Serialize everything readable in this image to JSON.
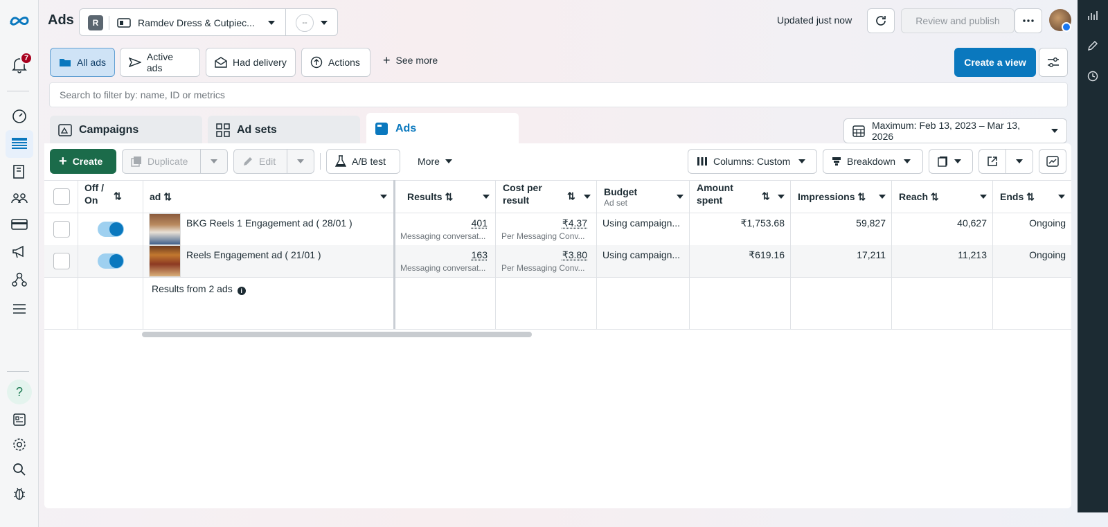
{
  "header": {
    "title": "Ads",
    "account_initial": "R",
    "account_name": "Ramdev Dress & Cutpiec...",
    "secondary_selector": "--",
    "updated": "Updated just now",
    "review_button": "Review and publish"
  },
  "leftnav": {
    "notification_count": "7"
  },
  "filters": {
    "chips": [
      "All ads",
      "Active ads",
      "Had delivery",
      "Actions"
    ],
    "see_more": "See more",
    "create_view": "Create a view",
    "search_placeholder": "Search to filter by: name, ID or metrics"
  },
  "tabs": [
    "Campaigns",
    "Ad sets",
    "Ads"
  ],
  "date_range": "Maximum: Feb 13, 2023 – Mar 13, 2026",
  "toolbar": {
    "create": "Create",
    "duplicate": "Duplicate",
    "edit": "Edit",
    "ab_test": "A/B test",
    "more": "More",
    "columns": "Columns: Custom",
    "breakdown": "Breakdown"
  },
  "table": {
    "headers": {
      "offon": "Off / On",
      "ad": "ad",
      "results": "Results",
      "cost": "Cost per result",
      "budget": "Budget",
      "budget_sub": "Ad set",
      "amount": "Amount spent",
      "impressions": "Impressions",
      "reach": "Reach",
      "ends": "Ends"
    },
    "rows": [
      {
        "name": "BKG Reels 1 Engagement ad ( 28/01 )",
        "results": "401",
        "results_sub": "Messaging conversat...",
        "cost": "₹4.37",
        "cost_sub": "Per Messaging Conv...",
        "budget": "Using campaign...",
        "amount": "₹1,753.68",
        "impressions": "59,827",
        "reach": "40,627",
        "ends": "Ongoing"
      },
      {
        "name": "Reels Engagement ad ( 21/01 )",
        "results": "163",
        "results_sub": "Messaging conversat...",
        "cost": "₹3.80",
        "cost_sub": "Per Messaging Conv...",
        "budget": "Using campaign...",
        "amount": "₹619.16",
        "impressions": "17,211",
        "reach": "11,213",
        "ends": "Ongoing"
      }
    ],
    "summary": "Results from 2 ads"
  }
}
